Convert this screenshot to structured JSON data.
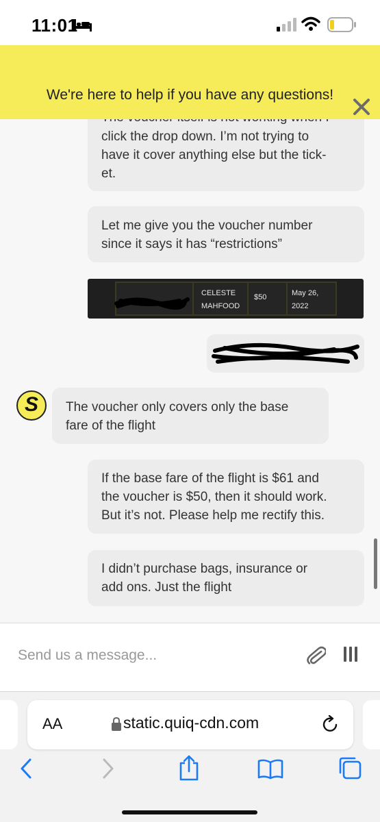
{
  "status_bar": {
    "time": "11:01"
  },
  "banner": {
    "text": "We're here to help if you have any questions!"
  },
  "messages": [
    {
      "lines": [
        "The voucher itself is not working when I",
        "click the drop down. I’m not trying to",
        "have it cover anything else but the tick-",
        "et."
      ]
    },
    {
      "lines": [
        "Let me give you the voucher number",
        "since it says it has “restrictions”"
      ]
    },
    {
      "lines": [
        "The voucher only covers only the base",
        "fare of the flight"
      ]
    },
    {
      "lines": [
        "If the base fare of the flight is $61 and",
        "the voucher is $50, then it should work.",
        "But it’s not. Please help me rectify this."
      ]
    },
    {
      "lines": [
        "I didn’t purchase bags, insurance or",
        "add ons. Just the flight"
      ]
    }
  ],
  "voucher_image": {
    "name_line1": "CELESTE",
    "name_line2": "MAHFOOD",
    "amount": "$50",
    "date_line1": "May 26,",
    "date_line2": "2022"
  },
  "agent_avatar": {
    "letter": "S",
    "color": "#f6ec5a"
  },
  "composer": {
    "placeholder": "Send us a message..."
  },
  "browser": {
    "text_size_label": "AA",
    "url": "static.quiq-cdn.com",
    "accent_color": "#1a7af8"
  },
  "colors": {
    "banner": "#f6ec5a",
    "bubble": "#ececec",
    "chat_background": "#f7f7f7"
  }
}
